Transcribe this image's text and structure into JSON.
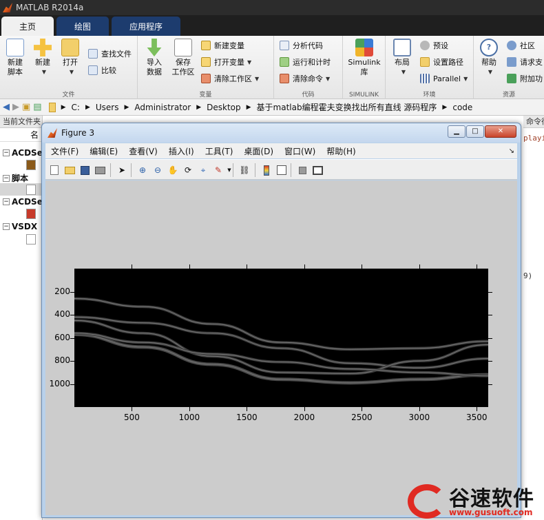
{
  "app": {
    "title": "MATLAB R2014a"
  },
  "ribbon_tabs": [
    "主页",
    "绘图",
    "应用程序"
  ],
  "ribbon": {
    "file": {
      "label": "文件",
      "new_script": "新建\n脚本",
      "new": "新建",
      "open": "打开",
      "find_files": "查找文件",
      "compare": "比较"
    },
    "variable": {
      "label": "变量",
      "import": "导入\n数据",
      "save_ws": "保存\n工作区",
      "new_var": "新建变量",
      "open_var": "打开变量",
      "clear_ws": "清除工作区"
    },
    "code": {
      "label": "代码",
      "analyze": "分析代码",
      "run_time": "运行和计时",
      "clear_cmd": "清除命令"
    },
    "simulink": {
      "label": "SIMULINK",
      "library": "Simulink\n库"
    },
    "env": {
      "label": "环境",
      "layout": "布局",
      "prefs": "预设",
      "set_path": "设置路径",
      "parallel": "Parallel"
    },
    "resources": {
      "label": "资源",
      "help": "帮助",
      "community": "社区",
      "request": "请求支",
      "addons": "附加功"
    }
  },
  "address": {
    "crumbs": [
      "C:",
      "Users",
      "Administrator",
      "Desktop",
      "基于matlab编程霍夫变换找出所有直线 源码程序",
      "code"
    ]
  },
  "left_pane": {
    "header": "当前文件夹",
    "col": "名",
    "items": [
      "ACDSe",
      "脚本",
      "ACDSe",
      "VSDX"
    ]
  },
  "right_pane": {
    "header": "命令行窗口",
    "snippet1": "playi",
    "snippet2": "9)"
  },
  "figure": {
    "title": "Figure 3",
    "menus": [
      "文件(F)",
      "编辑(E)",
      "查看(V)",
      "插入(I)",
      "工具(T)",
      "桌面(D)",
      "窗口(W)",
      "帮助(H)"
    ],
    "toolbar_icons": [
      "new-figure-icon",
      "open-icon",
      "save-icon",
      "print-icon",
      "pointer-icon",
      "zoom-in-icon",
      "zoom-out-icon",
      "pan-icon",
      "rotate-icon",
      "data-cursor-icon",
      "brush-icon",
      "link-icon",
      "colorbar-icon",
      "legend-icon",
      "hide-tools-icon",
      "show-tools-icon"
    ]
  },
  "chart_data": {
    "type": "heatmap",
    "title": "",
    "xlabel": "",
    "ylabel": "",
    "xlim": [
      0,
      3600
    ],
    "ylim": [
      1200,
      0
    ],
    "x_ticks": [
      500,
      1000,
      1500,
      2000,
      2500,
      3000,
      3500
    ],
    "y_ticks": [
      200,
      400,
      600,
      800,
      1000
    ],
    "colormap": "gray",
    "background": "#000000",
    "curves": [
      {
        "x": [
          0,
          600,
          1200,
          1800,
          2400,
          3000,
          3600
        ],
        "y": [
          260,
          330,
          480,
          640,
          700,
          690,
          630
        ]
      },
      {
        "x": [
          0,
          600,
          1200,
          1800,
          2400,
          3000,
          3600
        ],
        "y": [
          420,
          470,
          560,
          690,
          820,
          860,
          780
        ]
      },
      {
        "x": [
          0,
          600,
          1200,
          1800,
          2400,
          3000,
          3600
        ],
        "y": [
          570,
          680,
          830,
          960,
          990,
          960,
          920
        ]
      },
      {
        "x": [
          0,
          600,
          1200,
          1800,
          2400,
          3000,
          3600
        ],
        "y": [
          450,
          560,
          760,
          900,
          910,
          800,
          660
        ]
      },
      {
        "x": [
          0,
          600,
          1200,
          1800,
          2400,
          3000,
          3600
        ],
        "y": [
          560,
          640,
          740,
          810,
          870,
          900,
          930
        ]
      }
    ]
  },
  "watermark": {
    "name": "谷速软件",
    "url": "www.gusuoft.com"
  }
}
